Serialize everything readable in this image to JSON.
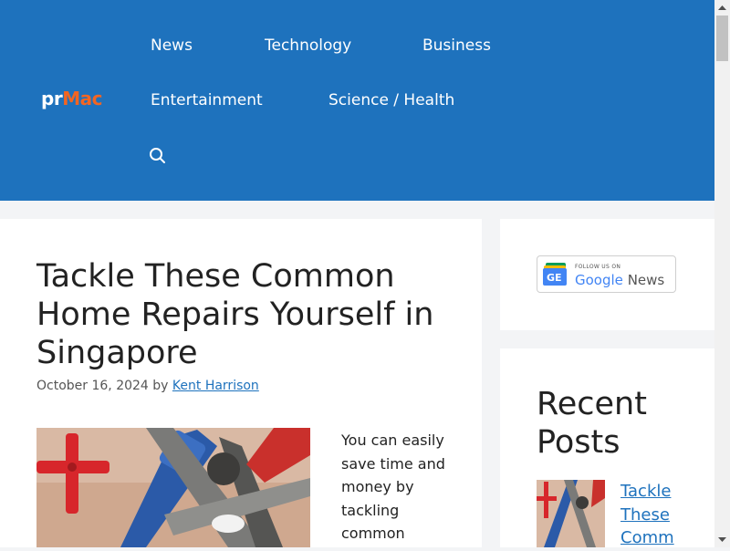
{
  "logo": {
    "part1": "pr",
    "part2": "Mac"
  },
  "nav": {
    "news": "News",
    "technology": "Technology",
    "business": "Business",
    "entertainment": "Entertainment",
    "science_health": "Science / Health",
    "search_icon": "search-icon"
  },
  "article": {
    "title": "Tackle These Common Home Repairs Yourself in Singapore",
    "date": "October 16, 2024",
    "by": "by",
    "author": "Kent Harrison",
    "excerpt": "You can easily save time and money by tackling common"
  },
  "sidebar": {
    "google_news": {
      "follow": "FOLLOW US ON",
      "google": "Google",
      "news": "News"
    },
    "recent_title": "Recent Posts",
    "recent_link": "Tackle\nThese\nComm"
  },
  "colors": {
    "header_bg": "#1e72bd",
    "logo_accent": "#f26522",
    "link": "#1e72bd"
  }
}
